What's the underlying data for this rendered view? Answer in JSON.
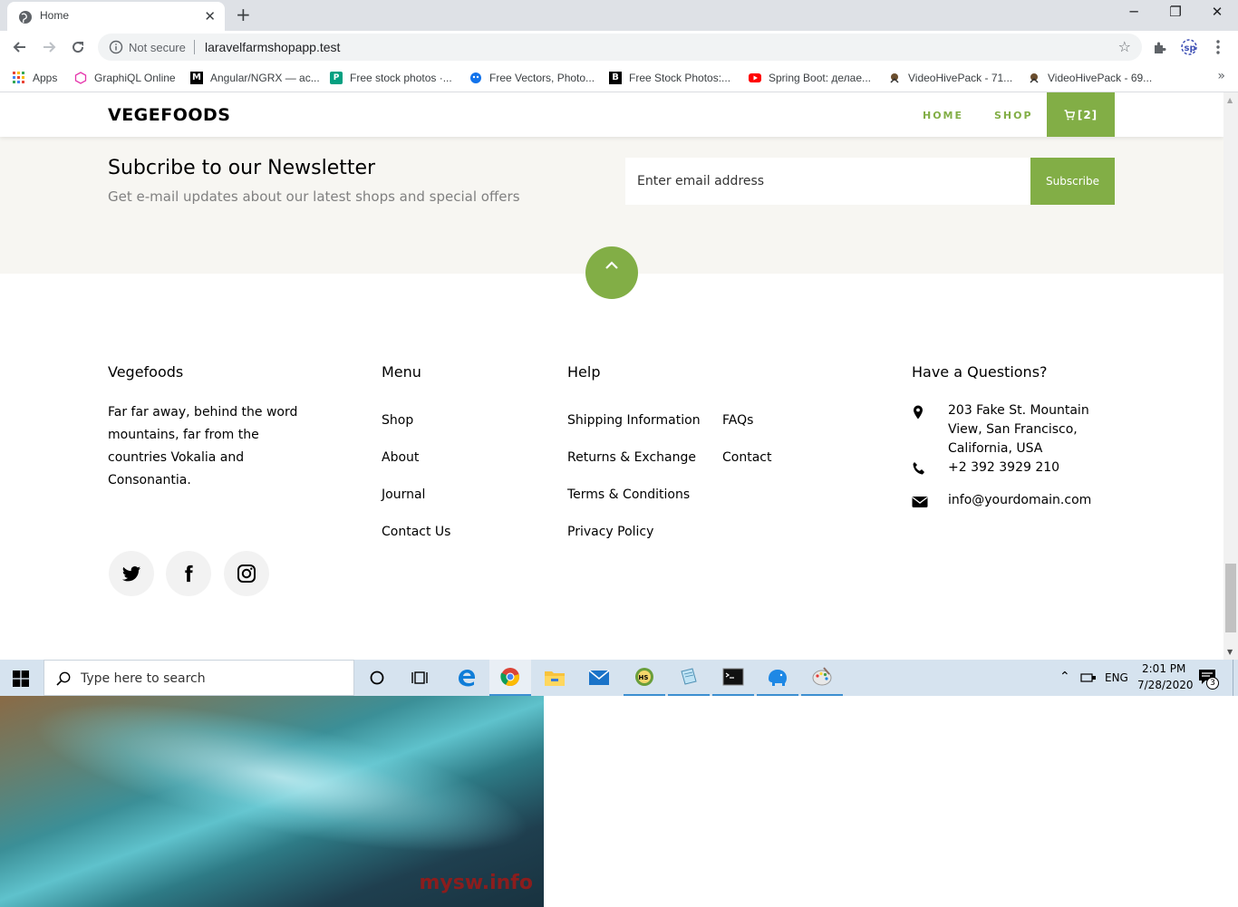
{
  "browser": {
    "tab_title": "Home",
    "tab_close": "✕",
    "new_tab": "+",
    "window_controls": {
      "minimize": "─",
      "maximize": "❐",
      "close": "✕"
    },
    "security_label": "Not secure",
    "url": "laravelfarmshopapp.test",
    "bookmarks": [
      {
        "label": "Apps",
        "icon": "apps-grid-icon"
      },
      {
        "label": "GraphiQL Online",
        "icon": "graphql-icon"
      },
      {
        "label": "Angular/NGRX — ac...",
        "icon": "medium-icon"
      },
      {
        "label": "Free stock photos ·...",
        "icon": "pexels-icon"
      },
      {
        "label": "Free Vectors, Photo...",
        "icon": "freepik-icon"
      },
      {
        "label": "Free Stock Photos:...",
        "icon": "burst-icon"
      },
      {
        "label": "Spring Boot: делае...",
        "icon": "youtube-icon"
      },
      {
        "label": "VideoHivePack - 71...",
        "icon": "videohive-icon"
      },
      {
        "label": "VideoHivePack - 69...",
        "icon": "videohive-icon"
      }
    ],
    "more": "»"
  },
  "site": {
    "brand": "VEGEFOODS",
    "nav": {
      "home": "HOME",
      "shop": "SHOP",
      "cart": "[2]"
    },
    "newsletter": {
      "title": "Subcribe to our Newsletter",
      "subtitle": "Get e-mail updates about our latest shops and special offers",
      "placeholder": "Enter email address",
      "button": "Subscribe"
    },
    "footer": {
      "about": {
        "heading": "Vegefoods",
        "lines": [
          "Far far away, behind the word",
          "mountains, far from the",
          "countries Vokalia and",
          "Consonantia."
        ]
      },
      "menu": {
        "heading": "Menu",
        "links": [
          "Shop",
          "About",
          "Journal",
          "Contact Us"
        ]
      },
      "help": {
        "heading": "Help",
        "col1": [
          "Shipping Information",
          "Returns & Exchange",
          "Terms & Conditions",
          "Privacy Policy"
        ],
        "col2": [
          "FAQs",
          "Contact"
        ]
      },
      "contact": {
        "heading": "Have a Questions?",
        "address": [
          "203 Fake St. Mountain",
          "View, San Francisco,",
          "California, USA"
        ],
        "phone": "+2 392 3929 210",
        "email": "info@yourdomain.com"
      }
    }
  },
  "taskbar": {
    "search_placeholder": "Type here to search",
    "language": "ENG",
    "time": "2:01 PM",
    "date": "7/28/2020",
    "notifications": "3"
  },
  "wallpaper": {
    "watermark": "mysw.info"
  },
  "colors": {
    "accent": "#82ae46",
    "newsletter_bg": "#f7f6f2",
    "taskbar_bg": "#d6e3ef"
  }
}
